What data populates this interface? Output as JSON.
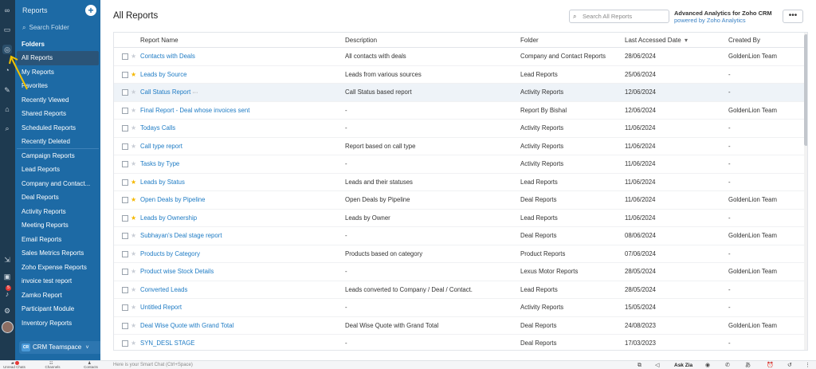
{
  "sidebar": {
    "title": "Reports",
    "add_label": "+",
    "search_placeholder": "Search Folder",
    "folders_heading": "Folders",
    "items": [
      {
        "label": "All Reports",
        "active": true
      },
      {
        "label": "My Reports"
      },
      {
        "label": "Favorites"
      },
      {
        "label": "Recently Viewed"
      },
      {
        "label": "Shared Reports"
      },
      {
        "label": "Scheduled Reports"
      },
      {
        "label": "Recently Deleted"
      },
      {
        "label": "Campaign Reports"
      },
      {
        "label": "Lead Reports"
      },
      {
        "label": "Company and Contact..."
      },
      {
        "label": "Deal Reports"
      },
      {
        "label": "Activity Reports"
      },
      {
        "label": "Meeting Reports"
      },
      {
        "label": "Email Reports"
      },
      {
        "label": "Sales Metrics Reports"
      },
      {
        "label": "Zoho Expense Reports"
      },
      {
        "label": "invoice test report"
      },
      {
        "label": "Zamko Report"
      },
      {
        "label": "Participant Module"
      },
      {
        "label": "Inventory Reports"
      }
    ],
    "team_badge": "CR",
    "team_label": "CRM Teamspace",
    "team_chevron": "˅"
  },
  "rail": {
    "badge": "5"
  },
  "header": {
    "title": "All Reports",
    "search_placeholder": "Search All Reports",
    "analytics_title": "Advanced Analytics for Zoho CRM",
    "analytics_sub": "powered by Zoho Analytics",
    "more_label": "•••"
  },
  "table": {
    "columns": {
      "name": "Report Name",
      "description": "Description",
      "folder": "Folder",
      "last_accessed": "Last Accessed Date",
      "created_by": "Created By"
    },
    "sort_indicator": "▾",
    "rows": [
      {
        "name": "Contacts with Deals",
        "description": "All contacts with deals",
        "folder": "Company and Contact Reports",
        "date": "28/06/2024",
        "created_by": "GoldenLion Team",
        "starred": false
      },
      {
        "name": "Leads by Source",
        "description": "Leads from various sources",
        "folder": "Lead Reports",
        "date": "25/06/2024",
        "created_by": "-",
        "starred": true
      },
      {
        "name": "Call Status Report",
        "description": "Call Status based report",
        "folder": "Activity Reports",
        "date": "12/06/2024",
        "created_by": "-",
        "starred": false,
        "highlight": true
      },
      {
        "name": "Final Report - Deal whose invoices sent",
        "description": "-",
        "folder": "Report By Bishal",
        "date": "12/06/2024",
        "created_by": "GoldenLion Team",
        "starred": false
      },
      {
        "name": "Todays Calls",
        "description": "-",
        "folder": "Activity Reports",
        "date": "11/06/2024",
        "created_by": "-",
        "starred": false
      },
      {
        "name": "Call type report",
        "description": "Report based on call type",
        "folder": "Activity Reports",
        "date": "11/06/2024",
        "created_by": "-",
        "starred": false
      },
      {
        "name": "Tasks by Type",
        "description": "-",
        "folder": "Activity Reports",
        "date": "11/06/2024",
        "created_by": "-",
        "starred": false
      },
      {
        "name": "Leads by Status",
        "description": "Leads and their statuses",
        "folder": "Lead Reports",
        "date": "11/06/2024",
        "created_by": "-",
        "starred": true
      },
      {
        "name": "Open Deals by Pipeline",
        "description": "Open Deals by Pipeline",
        "folder": "Deal Reports",
        "date": "11/06/2024",
        "created_by": "GoldenLion Team",
        "starred": true
      },
      {
        "name": "Leads by Ownership",
        "description": "Leads by Owner",
        "folder": "Lead Reports",
        "date": "11/06/2024",
        "created_by": "-",
        "starred": true
      },
      {
        "name": "Subhayan's Deal stage report",
        "description": "-",
        "folder": "Deal Reports",
        "date": "08/06/2024",
        "created_by": "GoldenLion Team",
        "starred": false
      },
      {
        "name": "Products by Category",
        "description": "Products based on category",
        "folder": "Product Reports",
        "date": "07/06/2024",
        "created_by": "-",
        "starred": false
      },
      {
        "name": "Product wise Stock Details",
        "description": "-",
        "folder": "Lexus Motor Reports",
        "date": "28/05/2024",
        "created_by": "GoldenLion Team",
        "starred": false
      },
      {
        "name": "Converted Leads",
        "description": "Leads converted to Company / Deal / Contact.",
        "folder": "Lead Reports",
        "date": "28/05/2024",
        "created_by": "-",
        "starred": false
      },
      {
        "name": "Untitled Report",
        "description": "-",
        "folder": "Activity Reports",
        "date": "15/05/2024",
        "created_by": "-",
        "starred": false
      },
      {
        "name": "Deal Wise Quote with Grand Total",
        "description": "Deal Wise Quote with Grand Total",
        "folder": "Deal Reports",
        "date": "24/08/2023",
        "created_by": "GoldenLion Team",
        "starred": false
      },
      {
        "name": "SYN_DESL STAGE",
        "description": "-",
        "folder": "Deal Reports",
        "date": "17/03/2023",
        "created_by": "-",
        "starred": false
      }
    ]
  },
  "bottom_bar": {
    "tabs": [
      {
        "label": "Unread Chats",
        "icon": "chat-icon"
      },
      {
        "label": "Channels",
        "icon": "channels-icon"
      },
      {
        "label": "Contacts",
        "icon": "contacts-icon"
      }
    ],
    "smart_chat": "Here is your Smart Chat (Ctrl+Space)",
    "ask_zia": "Ask Zia"
  }
}
